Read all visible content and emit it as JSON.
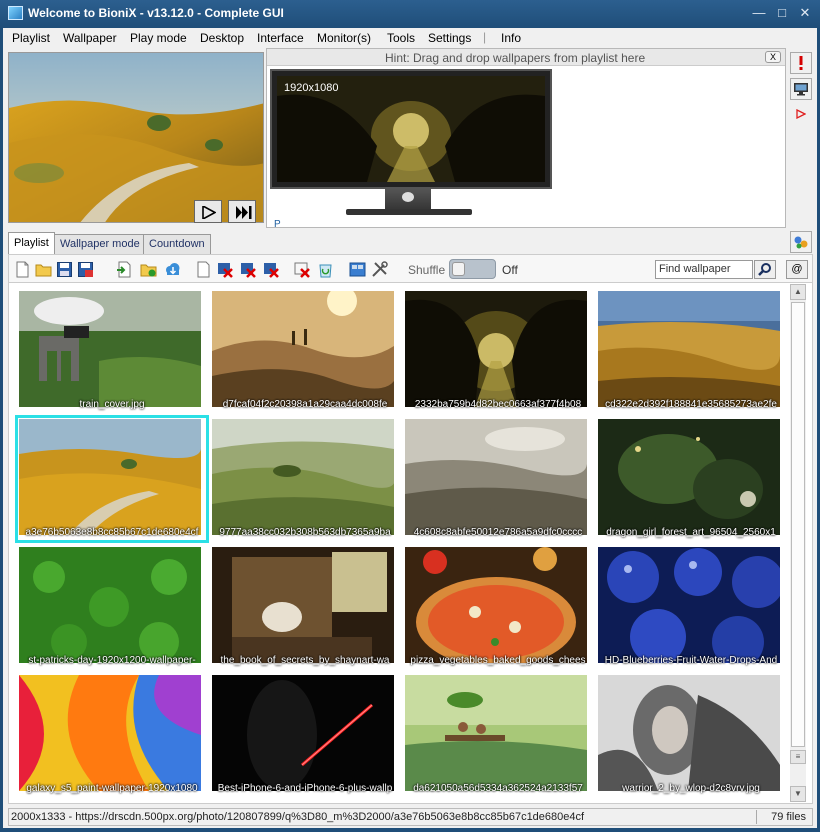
{
  "window": {
    "title": "Welcome to BioniX - v13.12.0 - Complete GUI",
    "controls": {
      "minimize": "—",
      "restore": "□",
      "close": "✕"
    }
  },
  "menu": [
    "Playlist",
    "Wallpaper",
    "Play mode",
    "Desktop",
    "Interface",
    "Monitor(s)",
    "Tools",
    "Settings",
    "Info"
  ],
  "preview": {
    "play_icon": "play-icon",
    "next_icon": "skip-next-icon"
  },
  "hint": {
    "text": "Hint: Drag and drop wallpapers from playlist here",
    "close_label": "X"
  },
  "monitor": {
    "resolution": "1920x1080",
    "label": "P"
  },
  "side_buttons": [
    "alert-icon",
    "monitor-icon",
    "play-red-icon",
    "palette-icon"
  ],
  "tabs": [
    {
      "label": "Playlist",
      "active": true
    },
    {
      "label": "Wallpaper mode",
      "active": false
    },
    {
      "label": "Countdown",
      "active": false
    }
  ],
  "toolbar": {
    "icons": [
      "new-icon",
      "open-folder-icon",
      "save-icon",
      "save-as-icon",
      "import-icon",
      "add-folder-icon",
      "cloud-download-icon",
      "blank-page-icon",
      "remove-icon",
      "remove-missing-icon",
      "remove-all-icon",
      "delete-file-icon",
      "recycle-icon",
      "view-icon",
      "tools-icon"
    ],
    "shuffle_label": "Shuffle",
    "shuffle_state": "Off",
    "find_placeholder": "Find wallpaper",
    "at_label": "@"
  },
  "thumbnails": [
    {
      "caption": "train_cover.jpg",
      "selected": false
    },
    {
      "caption": "d7fcaf04f2c20398a1a29caa4dc008fe",
      "selected": false
    },
    {
      "caption": "2332ba759b4d82bec0663af377f4b08",
      "selected": false
    },
    {
      "caption": "cd322e2d392f188841e35685273ae2fe",
      "selected": false
    },
    {
      "caption": "a3e76b5063e8b8cc85b67c1de680e4cf",
      "selected": true
    },
    {
      "caption": "9777aa38cc032b308b563db7365a9ba",
      "selected": false
    },
    {
      "caption": "4c608c8abfe50012e786a5a9dfc0cccc",
      "selected": false
    },
    {
      "caption": "dragon_girl_forest_art_96504_2560x1",
      "selected": false
    },
    {
      "caption": "st-patricks-day-1920x1200-wallpaper-",
      "selected": false
    },
    {
      "caption": "the_book_of_secrets_by_shaynart-wa",
      "selected": false
    },
    {
      "caption": "pizza_vegetables_baked_goods_chees",
      "selected": false
    },
    {
      "caption": "HD-Blueberries-Fruit-Water-Drops-And",
      "selected": false
    },
    {
      "caption": "galaxy_s5_paint-wallpaper-1920x1080",
      "selected": false
    },
    {
      "caption": "Best-iPhone-6-and-iPhone-6-plus-wallp",
      "selected": false
    },
    {
      "caption": "da621050a56d5334a362524a2133f57",
      "selected": false
    },
    {
      "caption": "warrior_2_by_wlop-d2c8vrv.jpg",
      "selected": false
    }
  ],
  "status": {
    "path": "2000x1333 - https://drscdn.500px.org/photo/120807899/q%3D80_m%3D2000/a3e76b5063e8b8cc85b67c1de680e4cf",
    "count": "79 files"
  }
}
